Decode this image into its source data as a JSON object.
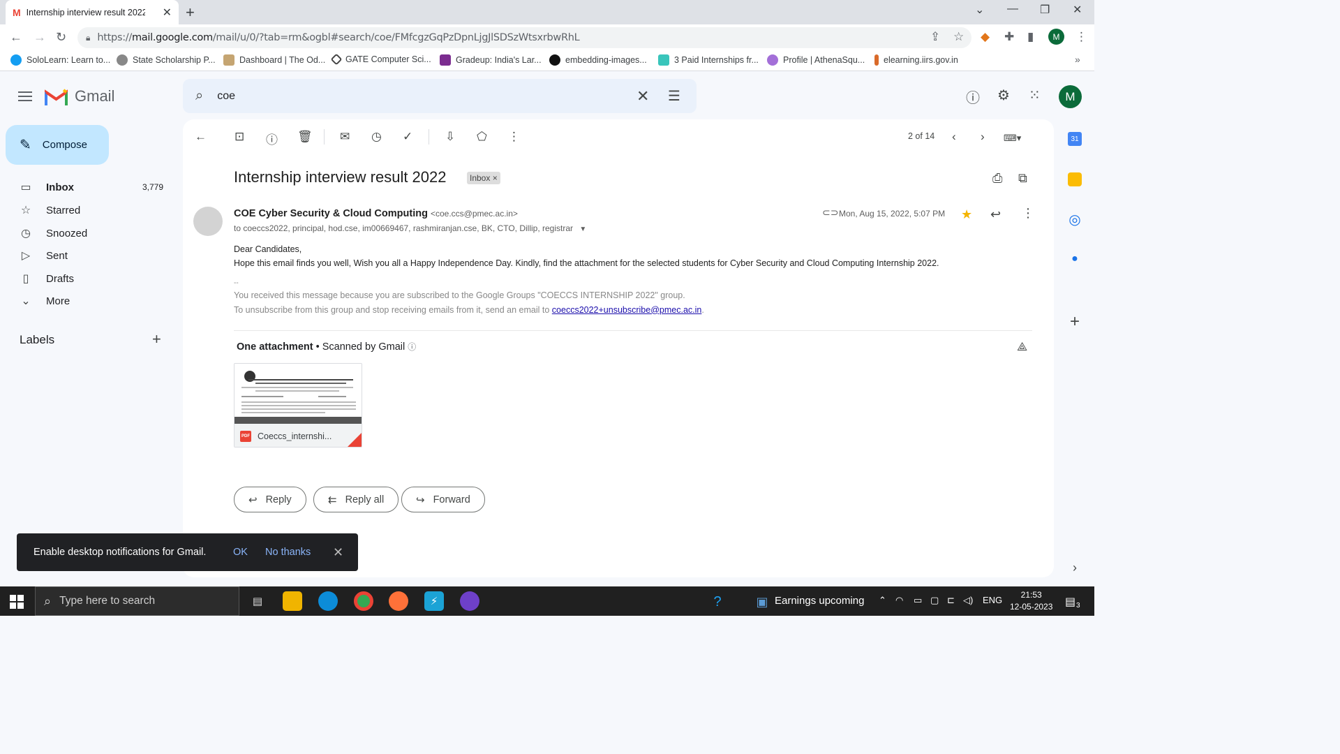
{
  "browser": {
    "tab_title": "Internship interview result 2022 -",
    "url_prefix": "https://",
    "url_host": "mail.google.com",
    "url_path": "/mail/u/0/?tab=rm&ogbl#search/coe/FMfcgzGqPzDpnLjgJlSDSzWtsxrbwRhL",
    "bookmarks": [
      {
        "label": "SoloLearn: Learn to...",
        "color": "#149ef2"
      },
      {
        "label": "State Scholarship P...",
        "color": "#888888"
      },
      {
        "label": "Dashboard | The Od...",
        "color": "#c5a572"
      },
      {
        "label": "GATE Computer Sci...",
        "color": "#444444"
      },
      {
        "label": "Gradeup: India's Lar...",
        "color": "#7b2c8f"
      },
      {
        "label": "embedding-images...",
        "color": "#111111"
      },
      {
        "label": "3 Paid Internships fr...",
        "color": "#39c5bb"
      },
      {
        "label": "Profile | AthenaSqu...",
        "color": "#a36fd8"
      },
      {
        "label": "elearning.iirs.gov.in",
        "color": "#d96a2a"
      }
    ],
    "profile_initial": "M"
  },
  "gmail": {
    "brand": "Gmail",
    "compose": "Compose",
    "nav": [
      {
        "label": "Inbox",
        "count": "3,779",
        "icon": "inbox-icon",
        "glyph": "▭"
      },
      {
        "label": "Starred",
        "count": "",
        "icon": "star-icon",
        "glyph": "☆"
      },
      {
        "label": "Snoozed",
        "count": "",
        "icon": "clock-icon",
        "glyph": "◷"
      },
      {
        "label": "Sent",
        "count": "",
        "icon": "send-icon",
        "glyph": "▷"
      },
      {
        "label": "Drafts",
        "count": "",
        "icon": "draft-icon",
        "glyph": "▯"
      },
      {
        "label": "More",
        "count": "",
        "icon": "chevron-down-icon",
        "glyph": "⌄"
      }
    ],
    "labels_heading": "Labels",
    "search_query": "coe",
    "avatar_initial": "M",
    "pager": "2 of 14"
  },
  "email": {
    "subject": "Internship interview result 2022",
    "chip": "Inbox",
    "sender_name": "COE Cyber Security & Cloud Computing",
    "sender_addr": "<coe.ccs@pmec.ac.in>",
    "to": "to coeccs2022, principal, hod.cse, im00669467, rashmiranjan.cse, BK, CTO, Dillip, registrar",
    "date": "Mon, Aug 15, 2022, 5:07 PM",
    "greeting": "Dear Candidates,",
    "body": "Hope this email finds you well, Wish you all a Happy Independence Day. Kindly, find the attachment for the selected students for Cyber Security and Cloud Computing Internship 2022.",
    "sig_sep": "--",
    "footer1": "You received this message because you are subscribed to the Google Groups \"COECCS INTERNSHIP 2022\" group.",
    "footer2": "To unsubscribe from this group and stop receiving emails from it, send an email to",
    "unsub_link": "coeccs2022+unsubscribe@pmec.ac.in",
    "footer_end": ".",
    "attachments_title": "One attachment",
    "scanned": "Scanned by Gmail",
    "attachment_name": "Coeccs_internshi...",
    "reply": "Reply",
    "reply_all": "Reply all",
    "forward": "Forward"
  },
  "toast": {
    "message": "Enable desktop notifications for Gmail.",
    "ok": "OK",
    "no_thanks": "No thanks"
  },
  "taskbar": {
    "search_placeholder": "Type here to search",
    "weather": "Earnings upcoming",
    "lang": "ENG",
    "time": "21:53",
    "date": "12-05-2023",
    "notif_count": "3"
  }
}
